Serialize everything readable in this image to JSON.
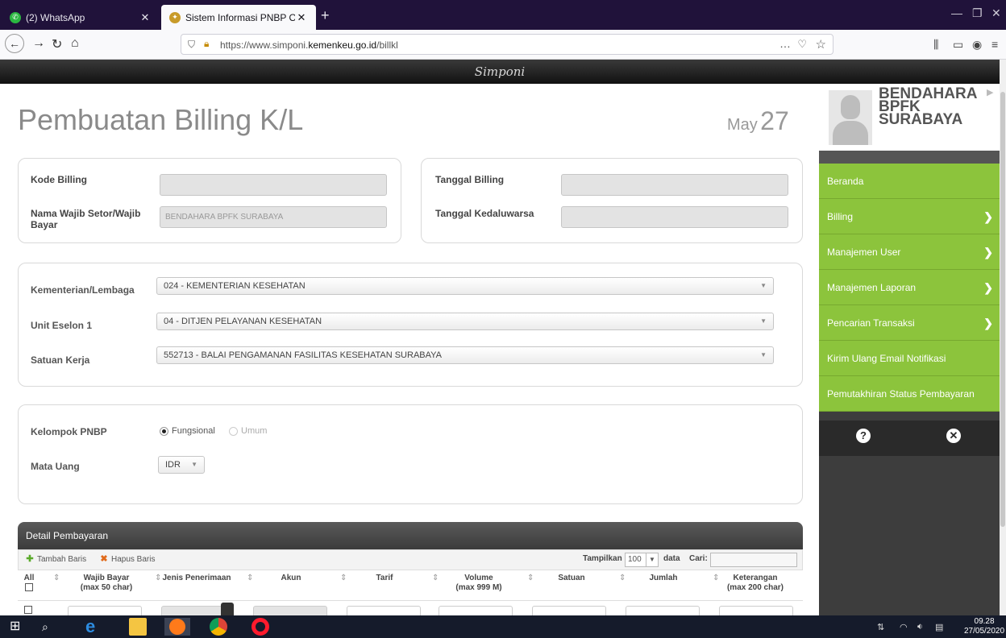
{
  "browser": {
    "tabs": [
      {
        "label": "(2) WhatsApp",
        "favicon": "whatsapp-icon",
        "active": false
      },
      {
        "label": "Sistem Informasi PNBP Online",
        "favicon": "kemenkeu-icon",
        "active": true
      }
    ],
    "url_prefix": "https://www.simponi.",
    "url_domain": "kemenkeu.go.id",
    "url_path": "/billkl",
    "url_more": "…"
  },
  "page": {
    "brand": "Simponi",
    "title": "Pembuatan Billing K/L",
    "date_month": "May",
    "date_day": "27"
  },
  "billing_panel": {
    "kode_billing_label": "Kode Billing",
    "kode_billing_value": "",
    "nama_label": "Nama Wajib Setor/Wajib Bayar",
    "nama_value": "BENDAHARA BPFK SURABAYA",
    "tanggal_billing_label": "Tanggal Billing",
    "tanggal_billing_value": "",
    "tanggal_kadaluwarsa_label": "Tanggal Kedaluwarsa",
    "tanggal_kadaluwarsa_value": ""
  },
  "org_panel": {
    "kl_label": "Kementerian/Lembaga",
    "kl_value": "024 - KEMENTERIAN KESEHATAN",
    "eselon_label": "Unit Eselon 1",
    "eselon_value": "04 - DITJEN PELAYANAN KESEHATAN",
    "satker_label": "Satuan Kerja",
    "satker_value": "552713 - BALAI PENGAMANAN FASILITAS KESEHATAN SURABAYA"
  },
  "pnbp_panel": {
    "kelompok_label": "Kelompok PNBP",
    "options": [
      "Fungsional",
      "Umum"
    ],
    "selected": "Fungsional",
    "mata_uang_label": "Mata Uang",
    "mata_uang_value": "IDR"
  },
  "detail": {
    "title": "Detail Pembayaran",
    "add_row": "Tambah Baris",
    "delete_row": "Hapus Baris",
    "show_label": "Tampilkan",
    "show_value": "100",
    "data_label": "data",
    "search_label": "Cari:",
    "columns": {
      "all": "All",
      "wajib_bayar": "Wajib Bayar",
      "wajib_bayar_sub": "(max 50 char)",
      "jenis": "Jenis Penerimaan",
      "akun": "Akun",
      "tarif": "Tarif",
      "volume": "Volume",
      "volume_sub": "(max 999 M)",
      "satuan": "Satuan",
      "jumlah": "Jumlah",
      "keterangan": "Keterangan",
      "keterangan_sub": "(max 200 char)"
    }
  },
  "sidebar": {
    "user_line1": "BENDAHARA",
    "user_line2": "BPFK",
    "user_line3": "SURABAYA",
    "menu": [
      {
        "label": "Beranda",
        "has_sub": false
      },
      {
        "label": "Billing",
        "has_sub": true
      },
      {
        "label": "Manajemen User",
        "has_sub": true
      },
      {
        "label": "Manajemen Laporan",
        "has_sub": true
      },
      {
        "label": "Pencarian Transaksi",
        "has_sub": true
      },
      {
        "label": "Kirim Ulang Email Notifikasi",
        "has_sub": false
      },
      {
        "label": "Pemutakhiran Status Pembayaran",
        "has_sub": false
      }
    ],
    "accent_color": "#8cc43c"
  },
  "taskbar": {
    "time": "09.28",
    "date": "27/05/2020"
  }
}
